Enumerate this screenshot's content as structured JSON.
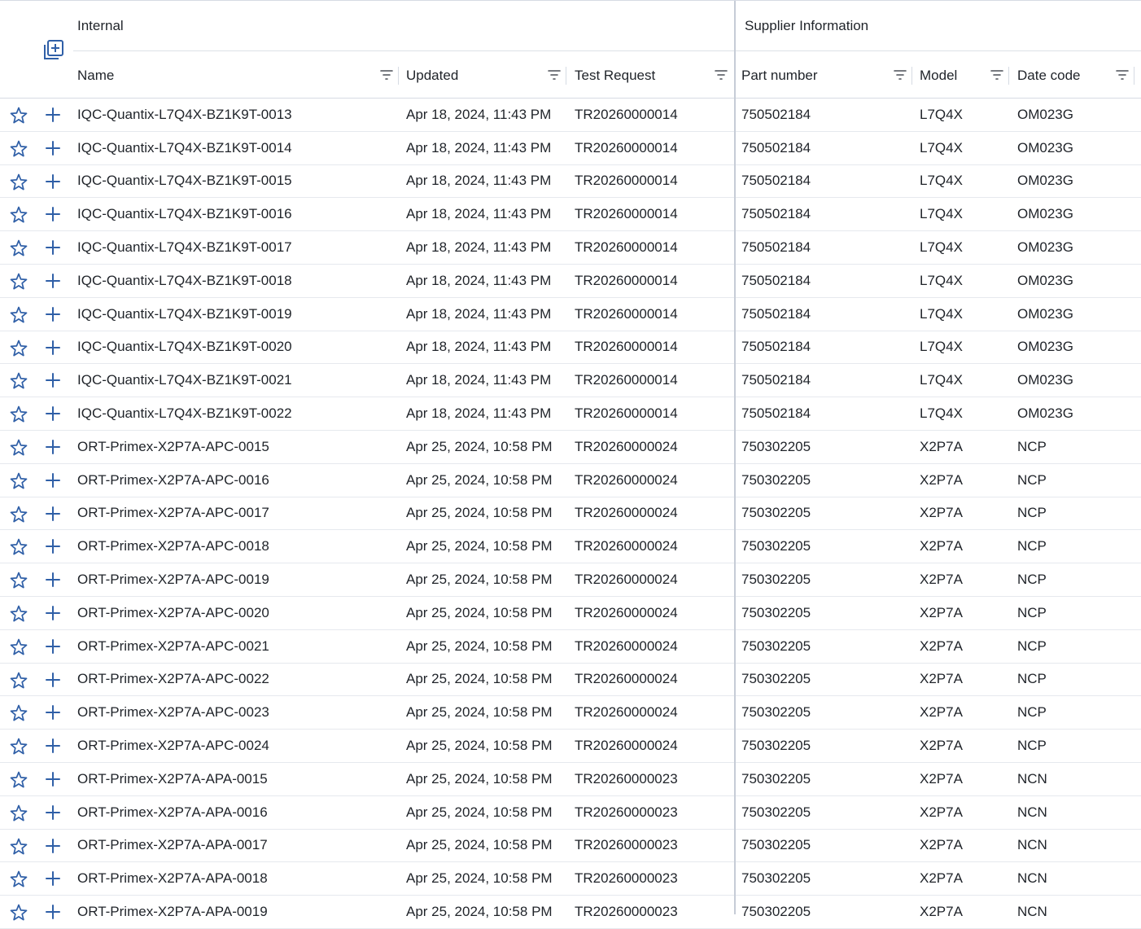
{
  "groups": {
    "internal": "Internal",
    "supplier": "Supplier Information"
  },
  "columns": {
    "name": "Name",
    "updated": "Updated",
    "test_request": "Test Request",
    "part_number": "Part number",
    "model": "Model",
    "date_code": "Date code"
  },
  "icons": {
    "add_column": "add-column-icon",
    "filter": "filter-icon",
    "favorite": "star-outline-icon",
    "add_row": "plus-icon"
  },
  "colors": {
    "accent": "#2f5fa7",
    "divider": "#c6ccd6"
  },
  "rows": [
    {
      "name": "IQC-Quantix-L7Q4X-BZ1K9T-0013",
      "updated": "Apr 18, 2024, 11:43 PM",
      "test_request": "TR20260000014",
      "part_number": "750502184",
      "model": "L7Q4X",
      "date_code": "OM023G"
    },
    {
      "name": "IQC-Quantix-L7Q4X-BZ1K9T-0014",
      "updated": "Apr 18, 2024, 11:43 PM",
      "test_request": "TR20260000014",
      "part_number": "750502184",
      "model": "L7Q4X",
      "date_code": "OM023G"
    },
    {
      "name": "IQC-Quantix-L7Q4X-BZ1K9T-0015",
      "updated": "Apr 18, 2024, 11:43 PM",
      "test_request": "TR20260000014",
      "part_number": "750502184",
      "model": "L7Q4X",
      "date_code": "OM023G"
    },
    {
      "name": "IQC-Quantix-L7Q4X-BZ1K9T-0016",
      "updated": "Apr 18, 2024, 11:43 PM",
      "test_request": "TR20260000014",
      "part_number": "750502184",
      "model": "L7Q4X",
      "date_code": "OM023G"
    },
    {
      "name": "IQC-Quantix-L7Q4X-BZ1K9T-0017",
      "updated": "Apr 18, 2024, 11:43 PM",
      "test_request": "TR20260000014",
      "part_number": "750502184",
      "model": "L7Q4X",
      "date_code": "OM023G"
    },
    {
      "name": "IQC-Quantix-L7Q4X-BZ1K9T-0018",
      "updated": "Apr 18, 2024, 11:43 PM",
      "test_request": "TR20260000014",
      "part_number": "750502184",
      "model": "L7Q4X",
      "date_code": "OM023G"
    },
    {
      "name": "IQC-Quantix-L7Q4X-BZ1K9T-0019",
      "updated": "Apr 18, 2024, 11:43 PM",
      "test_request": "TR20260000014",
      "part_number": "750502184",
      "model": "L7Q4X",
      "date_code": "OM023G"
    },
    {
      "name": "IQC-Quantix-L7Q4X-BZ1K9T-0020",
      "updated": "Apr 18, 2024, 11:43 PM",
      "test_request": "TR20260000014",
      "part_number": "750502184",
      "model": "L7Q4X",
      "date_code": "OM023G"
    },
    {
      "name": "IQC-Quantix-L7Q4X-BZ1K9T-0021",
      "updated": "Apr 18, 2024, 11:43 PM",
      "test_request": "TR20260000014",
      "part_number": "750502184",
      "model": "L7Q4X",
      "date_code": "OM023G"
    },
    {
      "name": "IQC-Quantix-L7Q4X-BZ1K9T-0022",
      "updated": "Apr 18, 2024, 11:43 PM",
      "test_request": "TR20260000014",
      "part_number": "750502184",
      "model": "L7Q4X",
      "date_code": "OM023G"
    },
    {
      "name": "ORT-Primex-X2P7A-APC-0015",
      "updated": "Apr 25, 2024, 10:58 PM",
      "test_request": "TR20260000024",
      "part_number": "750302205",
      "model": "X2P7A",
      "date_code": "NCP"
    },
    {
      "name": "ORT-Primex-X2P7A-APC-0016",
      "updated": "Apr 25, 2024, 10:58 PM",
      "test_request": "TR20260000024",
      "part_number": "750302205",
      "model": "X2P7A",
      "date_code": "NCP"
    },
    {
      "name": "ORT-Primex-X2P7A-APC-0017",
      "updated": "Apr 25, 2024, 10:58 PM",
      "test_request": "TR20260000024",
      "part_number": "750302205",
      "model": "X2P7A",
      "date_code": "NCP"
    },
    {
      "name": "ORT-Primex-X2P7A-APC-0018",
      "updated": "Apr 25, 2024, 10:58 PM",
      "test_request": "TR20260000024",
      "part_number": "750302205",
      "model": "X2P7A",
      "date_code": "NCP"
    },
    {
      "name": "ORT-Primex-X2P7A-APC-0019",
      "updated": "Apr 25, 2024, 10:58 PM",
      "test_request": "TR20260000024",
      "part_number": "750302205",
      "model": "X2P7A",
      "date_code": "NCP"
    },
    {
      "name": "ORT-Primex-X2P7A-APC-0020",
      "updated": "Apr 25, 2024, 10:58 PM",
      "test_request": "TR20260000024",
      "part_number": "750302205",
      "model": "X2P7A",
      "date_code": "NCP"
    },
    {
      "name": "ORT-Primex-X2P7A-APC-0021",
      "updated": "Apr 25, 2024, 10:58 PM",
      "test_request": "TR20260000024",
      "part_number": "750302205",
      "model": "X2P7A",
      "date_code": "NCP"
    },
    {
      "name": "ORT-Primex-X2P7A-APC-0022",
      "updated": "Apr 25, 2024, 10:58 PM",
      "test_request": "TR20260000024",
      "part_number": "750302205",
      "model": "X2P7A",
      "date_code": "NCP"
    },
    {
      "name": "ORT-Primex-X2P7A-APC-0023",
      "updated": "Apr 25, 2024, 10:58 PM",
      "test_request": "TR20260000024",
      "part_number": "750302205",
      "model": "X2P7A",
      "date_code": "NCP"
    },
    {
      "name": "ORT-Primex-X2P7A-APC-0024",
      "updated": "Apr 25, 2024, 10:58 PM",
      "test_request": "TR20260000024",
      "part_number": "750302205",
      "model": "X2P7A",
      "date_code": "NCP"
    },
    {
      "name": "ORT-Primex-X2P7A-APA-0015",
      "updated": "Apr 25, 2024, 10:58 PM",
      "test_request": "TR20260000023",
      "part_number": "750302205",
      "model": "X2P7A",
      "date_code": "NCN"
    },
    {
      "name": "ORT-Primex-X2P7A-APA-0016",
      "updated": "Apr 25, 2024, 10:58 PM",
      "test_request": "TR20260000023",
      "part_number": "750302205",
      "model": "X2P7A",
      "date_code": "NCN"
    },
    {
      "name": "ORT-Primex-X2P7A-APA-0017",
      "updated": "Apr 25, 2024, 10:58 PM",
      "test_request": "TR20260000023",
      "part_number": "750302205",
      "model": "X2P7A",
      "date_code": "NCN"
    },
    {
      "name": "ORT-Primex-X2P7A-APA-0018",
      "updated": "Apr 25, 2024, 10:58 PM",
      "test_request": "TR20260000023",
      "part_number": "750302205",
      "model": "X2P7A",
      "date_code": "NCN"
    },
    {
      "name": "ORT-Primex-X2P7A-APA-0019",
      "updated": "Apr 25, 2024, 10:58 PM",
      "test_request": "TR20260000023",
      "part_number": "750302205",
      "model": "X2P7A",
      "date_code": "NCN"
    }
  ]
}
